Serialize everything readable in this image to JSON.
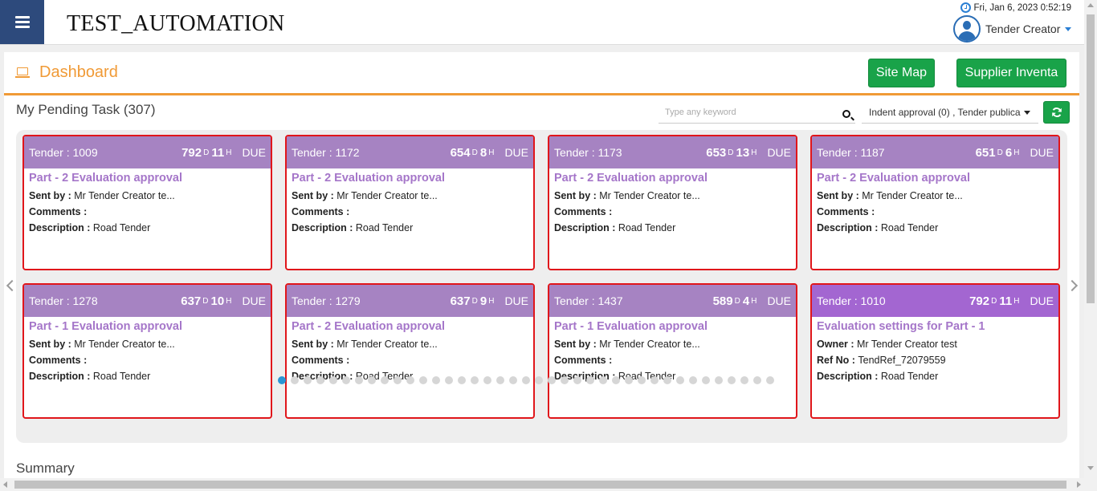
{
  "header": {
    "app_title": "TEST_AUTOMATION",
    "datetime": "Fri, Jan 6, 2023 0:52:19",
    "user_name": "Tender Creator"
  },
  "dashboard": {
    "title": "Dashboard",
    "site_map_label": "Site Map",
    "supplier_label": "Supplier Inventa"
  },
  "pending": {
    "title": "My Pending Task (307)",
    "search_placeholder": "Type any keyword",
    "filter_value": "Indent approval (0)  , Tender publica"
  },
  "cards": [
    {
      "tender": "Tender : 1009",
      "days": "792",
      "hours": "11",
      "due": "DUE",
      "task": "Part - 2 Evaluation approval",
      "l1": "Sent by : ",
      "v1": "Mr Tender Creator te...",
      "l2": "Comments : ",
      "v2": "",
      "l3": "Description : ",
      "v3": "Road Tender"
    },
    {
      "tender": "Tender : 1172",
      "days": "654",
      "hours": "8",
      "due": "DUE",
      "task": "Part - 2 Evaluation approval",
      "l1": "Sent by : ",
      "v1": "Mr Tender Creator te...",
      "l2": "Comments : ",
      "v2": "",
      "l3": "Description : ",
      "v3": "Road Tender"
    },
    {
      "tender": "Tender : 1173",
      "days": "653",
      "hours": "13",
      "due": "DUE",
      "task": "Part - 2 Evaluation approval",
      "l1": "Sent by : ",
      "v1": "Mr Tender Creator te...",
      "l2": "Comments : ",
      "v2": "",
      "l3": "Description : ",
      "v3": "Road Tender"
    },
    {
      "tender": "Tender : 1187",
      "days": "651",
      "hours": "6",
      "due": "DUE",
      "task": "Part - 2 Evaluation approval",
      "l1": "Sent by : ",
      "v1": "Mr Tender Creator te...",
      "l2": "Comments : ",
      "v2": "",
      "l3": "Description : ",
      "v3": "Road Tender"
    },
    {
      "tender": "Tender : 1278",
      "days": "637",
      "hours": "10",
      "due": "DUE",
      "task": "Part - 1 Evaluation approval",
      "l1": "Sent by : ",
      "v1": "Mr Tender Creator te...",
      "l2": "Comments : ",
      "v2": "",
      "l3": "Description : ",
      "v3": "Road Tender"
    },
    {
      "tender": "Tender : 1279",
      "days": "637",
      "hours": "9",
      "due": "DUE",
      "task": "Part - 2 Evaluation approval",
      "l1": "Sent by : ",
      "v1": "Mr Tender Creator te...",
      "l2": "Comments : ",
      "v2": "",
      "l3": "Description : ",
      "v3": "Road Tender"
    },
    {
      "tender": "Tender : 1437",
      "days": "589",
      "hours": "4",
      "due": "DUE",
      "task": "Part - 1 Evaluation approval",
      "l1": "Sent by : ",
      "v1": "Mr Tender Creator te...",
      "l2": "Comments : ",
      "v2": "",
      "l3": "Description : ",
      "v3": "Road Tender"
    },
    {
      "tender": "Tender : 1010",
      "days": "792",
      "hours": "11",
      "due": "DUE",
      "task": "Evaluation settings for Part - 1",
      "l1": "Owner : ",
      "v1": "Mr Tender Creator test",
      "l2": "Ref No : ",
      "v2": "TendRef_72079559",
      "l3": "Description : ",
      "v3": "Road Tender"
    }
  ],
  "time_units": {
    "day": "D",
    "hour": "H"
  },
  "summary": {
    "title": "Summary"
  },
  "colors": {
    "menu_bg": "#2d4a7c",
    "accent_orange": "#f09a36",
    "button_green": "#19a349",
    "card_header": "#a683c2",
    "card_header_alt": "#a366d1",
    "card_border": "#e0161b",
    "dot_active": "#2a95d4"
  }
}
